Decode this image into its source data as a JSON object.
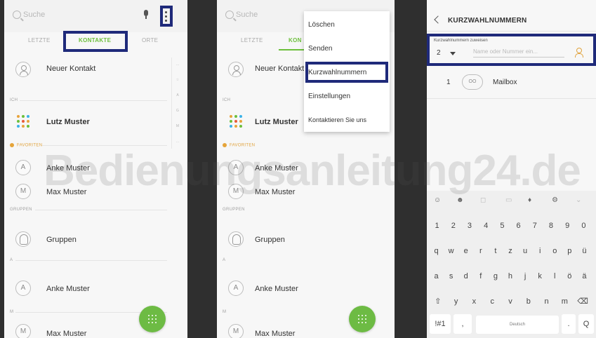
{
  "search": {
    "placeholder": "Suche"
  },
  "tabs": [
    "LETZTE",
    "KONTAKTE",
    "ORTE"
  ],
  "contacts": {
    "new_contact": "Neuer Kontakt",
    "me_section": "ICH",
    "me_name": "Lutz Muster",
    "favorites_section": "FAVORITEN",
    "favorites": [
      {
        "initial": "A",
        "name": "Anke Muster"
      },
      {
        "initial": "M",
        "name": "Max Muster"
      }
    ],
    "groups_section": "GRUPPEN",
    "groups_label": "Gruppen",
    "section_a": "A",
    "list_a": [
      {
        "initial": "A",
        "name": "Anke Muster"
      }
    ],
    "section_m": "M",
    "list_m": [
      {
        "initial": "M",
        "name": "Max Muster"
      }
    ]
  },
  "index_letters": [
    "…",
    "☆",
    "A",
    "G",
    "M",
    "…"
  ],
  "menu": {
    "items": [
      "Löschen",
      "Senden",
      "Kurzwahlnummern",
      "Einstellungen",
      "Kontaktieren Sie uns"
    ],
    "highlighted": "Kurzwahlnummern"
  },
  "speed_dial": {
    "title": "KURZWAHLNUMMERN",
    "assign_label": "Kurzwahlnummern zuweisen",
    "assign_number": "2",
    "name_placeholder": "Name oder Nummer ein...",
    "entries": [
      {
        "number": "1",
        "avatar": "OO",
        "name": "Mailbox"
      }
    ]
  },
  "keyboard": {
    "top_icons": [
      "emoji-smiley",
      "emoji",
      "sticker",
      "gif",
      "mic",
      "gear",
      "more"
    ],
    "rows": [
      [
        "1",
        "2",
        "3",
        "4",
        "5",
        "6",
        "7",
        "8",
        "9",
        "0"
      ],
      [
        "q",
        "w",
        "e",
        "r",
        "t",
        "z",
        "u",
        "i",
        "o",
        "p",
        "ü"
      ],
      [
        "a",
        "s",
        "d",
        "f",
        "g",
        "h",
        "j",
        "k",
        "l",
        "ö",
        "ä"
      ],
      [
        "⇧",
        "y",
        "x",
        "c",
        "v",
        "b",
        "n",
        "m",
        "⌫"
      ]
    ],
    "bottom": {
      "symbols": "!#1",
      "comma": ",",
      "space": "Deutsch",
      "period": ".",
      "search": "Q"
    }
  },
  "watermark": "Bedienungsanleitung24.de",
  "colors": {
    "accent_green": "#6cbf3b",
    "highlight_blue": "#1f2a7a",
    "favorite_orange": "#e0a23b"
  }
}
